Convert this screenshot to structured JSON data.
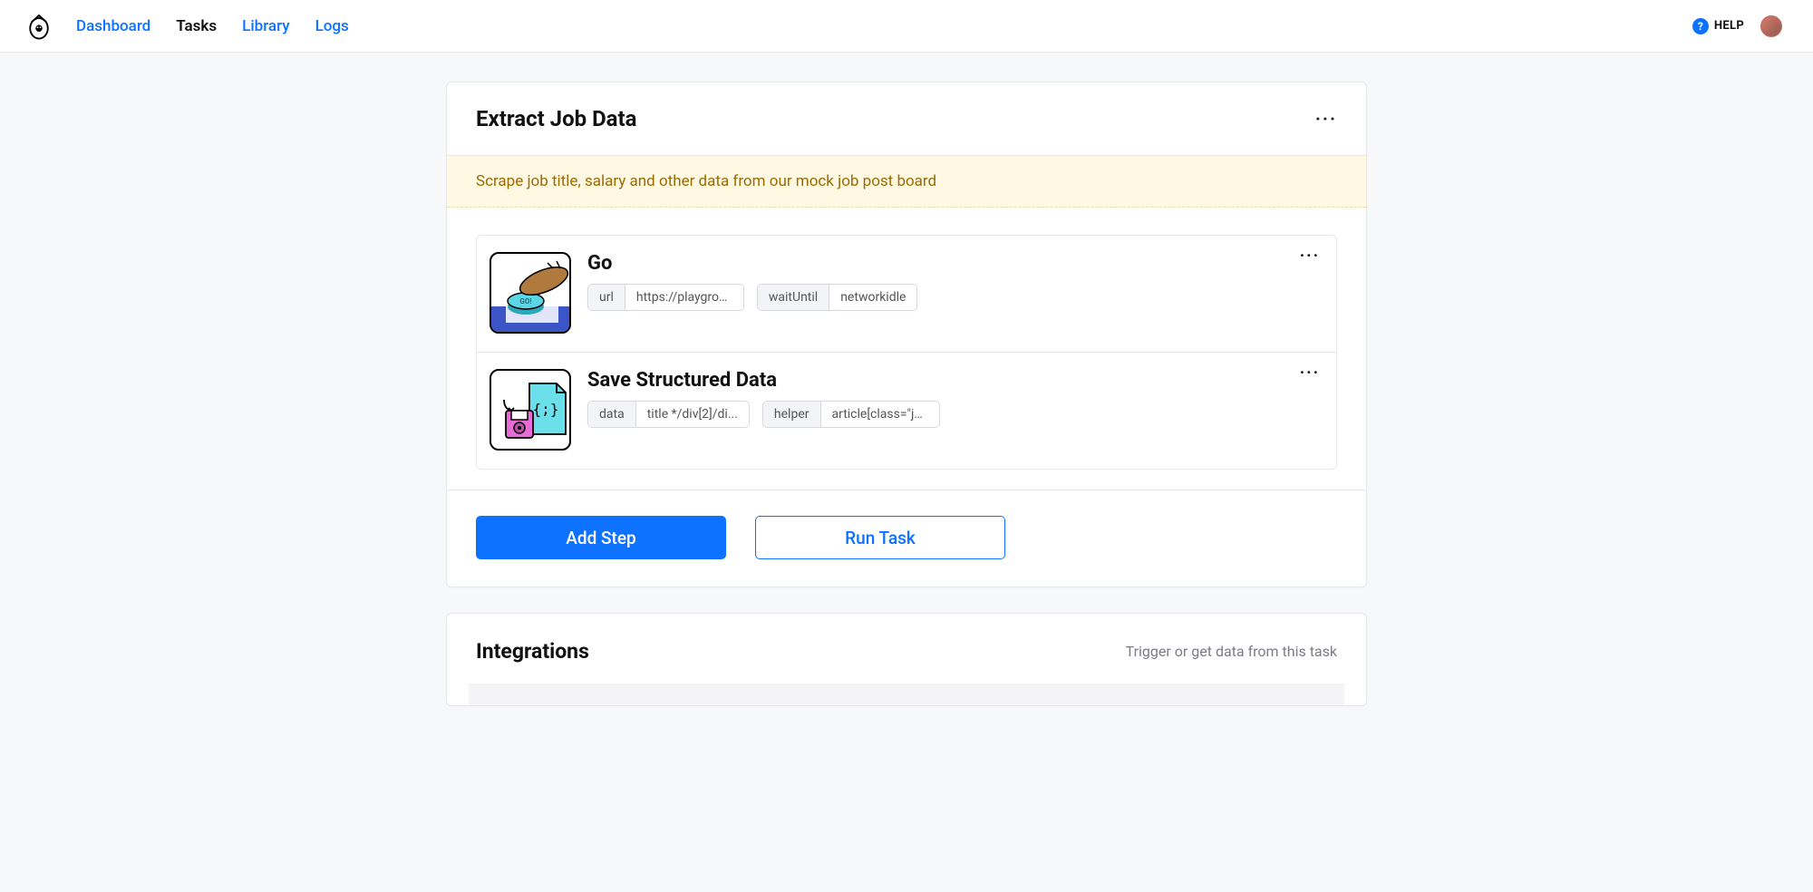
{
  "nav": {
    "items": [
      "Dashboard",
      "Tasks",
      "Library",
      "Logs"
    ],
    "active_index": 1,
    "help_label": "HELP"
  },
  "task": {
    "title": "Extract Job Data",
    "description": "Scrape job title, salary and other data from our mock job post board",
    "steps": [
      {
        "title": "Go",
        "params": [
          {
            "key": "url",
            "value": "https://playgroun..."
          },
          {
            "key": "waitUntil",
            "value": "networkidle"
          }
        ]
      },
      {
        "title": "Save Structured Data",
        "params": [
          {
            "key": "data",
            "value": "title */div[2]/di..."
          },
          {
            "key": "helper",
            "value": "article[class=\"jo..."
          }
        ]
      }
    ],
    "add_step_label": "Add Step",
    "run_task_label": "Run Task"
  },
  "integrations": {
    "title": "Integrations",
    "subtitle": "Trigger or get data from this task"
  }
}
